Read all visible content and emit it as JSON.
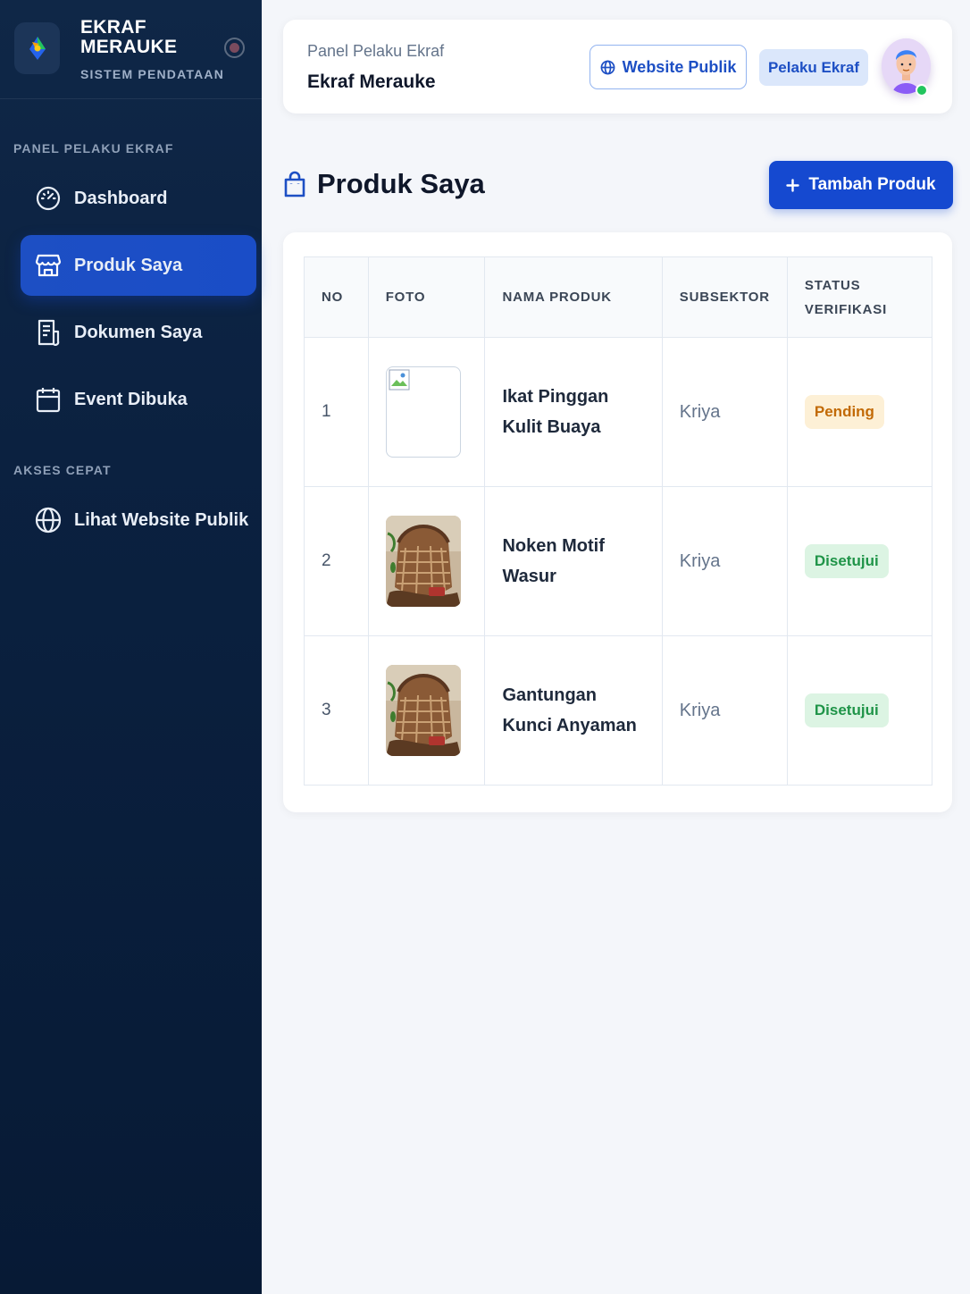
{
  "sidebar": {
    "brand_name_line1": "EKRAF",
    "brand_name_line2": "MERAUKE",
    "brand_subtitle": "SISTEM PENDATAAN",
    "section_panel": "PANEL PELAKU EKRAF",
    "section_quick": "AKSES CEPAT",
    "items": [
      {
        "label": "Dashboard",
        "icon": "gauge-icon",
        "active": false
      },
      {
        "label": "Produk Saya",
        "icon": "store-icon",
        "active": true
      },
      {
        "label": "Dokumen Saya",
        "icon": "document-icon",
        "active": false
      },
      {
        "label": "Event Dibuka",
        "icon": "calendar-icon",
        "active": false
      }
    ],
    "quick_items": [
      {
        "label": "Lihat Website Publik",
        "icon": "globe-icon"
      }
    ]
  },
  "header": {
    "subtitle": "Panel Pelaku Ekraf",
    "title": "Ekraf Merauke",
    "website_button": "Website Publik",
    "role_badge": "Pelaku Ekraf"
  },
  "page": {
    "title": "Produk Saya",
    "add_button": "Tambah Produk"
  },
  "table": {
    "columns": [
      "NO",
      "FOTO",
      "NAMA PRODUK",
      "SUBSEKTOR",
      "STATUS VERIFIKASI"
    ],
    "rows": [
      {
        "no": "1",
        "photo": "broken-image",
        "name": "Ikat Pinggan Kulit Buaya",
        "subsektor": "Kriya",
        "status": "Pending"
      },
      {
        "no": "2",
        "photo": "noken-bag-image",
        "name": "Noken Motif Wasur",
        "subsektor": "Kriya",
        "status": "Disetujui"
      },
      {
        "no": "3",
        "photo": "noken-bag-image",
        "name": "Gantungan Kunci Anyaman",
        "subsektor": "Kriya",
        "status": "Disetujui"
      }
    ]
  },
  "colors": {
    "sidebar_bg": "#0b2140",
    "accent": "#1549d0",
    "pending": "#c26a06",
    "approved": "#1f9448"
  }
}
